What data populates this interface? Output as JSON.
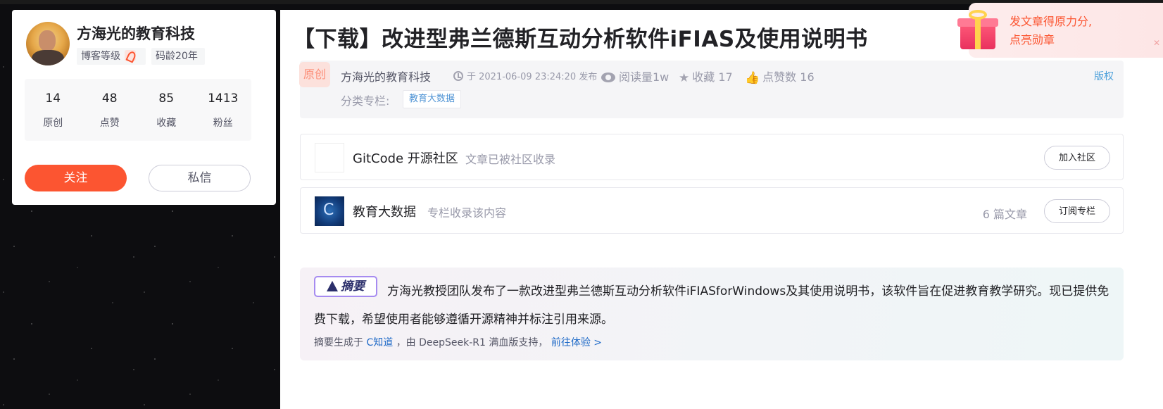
{
  "profile": {
    "name": "方海光的教育科技",
    "level_label": "博客等级",
    "coding_age": "码龄20年",
    "stats": [
      {
        "num": "14",
        "label": "原创"
      },
      {
        "num": "48",
        "label": "点赞"
      },
      {
        "num": "85",
        "label": "收藏"
      },
      {
        "num": "1413",
        "label": "粉丝"
      }
    ],
    "follow_label": "关注",
    "message_label": "私信"
  },
  "article": {
    "title": "【下载】改进型弗兰德斯互动分析软件iFIAS及使用说明书",
    "badge": "原创",
    "author": "方海光的教育科技",
    "time": "于 2021-06-09 23:24:20 发布",
    "reads": "阅读量1w",
    "favorites": "收藏 17",
    "likes": "点赞数 16",
    "copyright": "版权",
    "category_label": "分类专栏:",
    "category_tag": "教育大数据"
  },
  "community": {
    "name": "GitCode 开源社区",
    "desc": "文章已被社区收录",
    "button": "加入社区"
  },
  "column": {
    "name": "教育大数据",
    "desc": "专栏收录该内容",
    "count": "6 篇文章",
    "button": "订阅专栏"
  },
  "summary": {
    "badge": "摘要",
    "text": "方海光教授团队发布了一款改进型弗兰德斯互动分析软件iFIASforWindows及其使用说明书，该软件旨在促进教育教学研究。现已提供免费下载，希望使用者能够遵循开源精神并标注引用来源。",
    "foot_prefix": "摘要生成于",
    "foot_source": "C知道",
    "foot_middle": "，由 DeepSeek-R1 满血版支持，",
    "foot_link": "前往体验 >"
  },
  "promo": {
    "line1": "发文章得原力分,",
    "line2": "点亮勋章"
  },
  "colors": {
    "accent": "#fc5531",
    "link": "#1f6ac7"
  }
}
